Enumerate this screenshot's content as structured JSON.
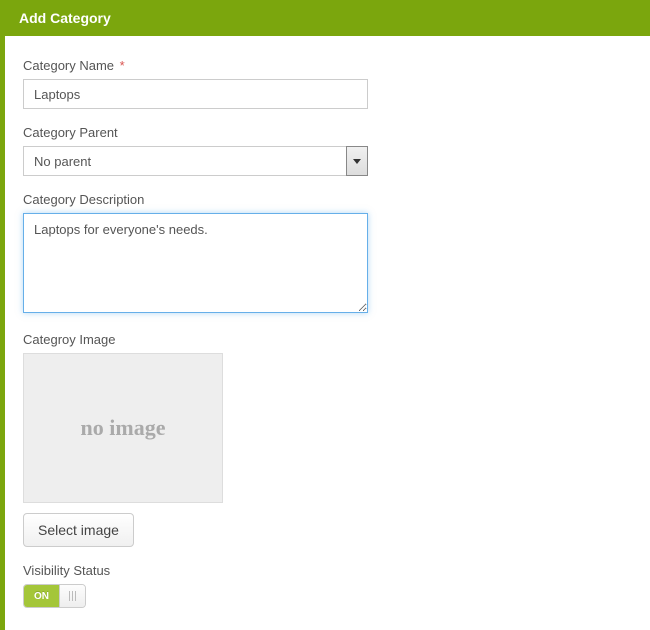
{
  "header": {
    "title": "Add Category"
  },
  "form": {
    "name": {
      "label": "Category Name",
      "required_mark": "*",
      "value": "Laptops"
    },
    "parent": {
      "label": "Category Parent",
      "selected": "No parent"
    },
    "description": {
      "label": "Category Description",
      "value": "Laptops for everyone's needs."
    },
    "image": {
      "label": "Categroy Image",
      "placeholder_text": "no image",
      "button_label": "Select image"
    },
    "visibility": {
      "label": "Visibility Status",
      "on_label": "ON"
    }
  }
}
